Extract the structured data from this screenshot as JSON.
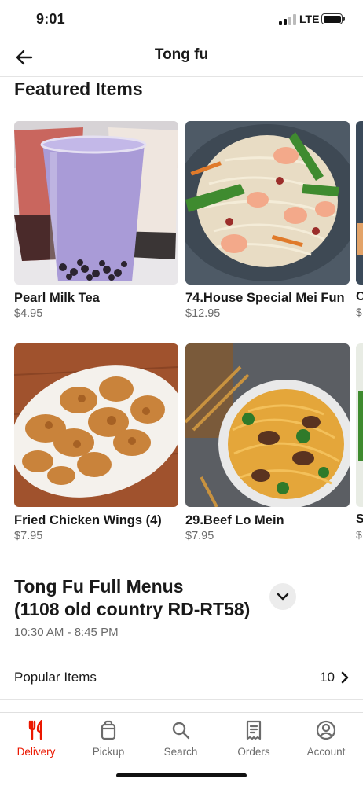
{
  "status_bar": {
    "time": "9:01",
    "network": "LTE"
  },
  "header": {
    "title": "Tong fu",
    "back_icon": "back-arrow-icon"
  },
  "featured": {
    "title": "Featured Items",
    "items": [
      {
        "name": "Pearl Milk Tea",
        "price": "$4.95"
      },
      {
        "name": "74.House Special Mei Fun",
        "price": "$12.95"
      },
      {
        "name": "Fried Chicken Wings (4)",
        "price": "$7.95"
      },
      {
        "name": "29.Beef  Lo Mein",
        "price": "$7.95"
      }
    ],
    "peek": {
      "top_name": "C",
      "top_price": "$",
      "bottom_name": "S",
      "bottom_price": "$"
    }
  },
  "menu": {
    "title_line1": "Tong Fu Full Menus",
    "title_line2": "(1108 old country RD-RT58)",
    "hours": "10:30 AM - 8:45 PM",
    "expand_icon": "chevron-down-icon"
  },
  "popular": {
    "label": "Popular Items",
    "count": "10"
  },
  "tabs": [
    {
      "label": "Delivery",
      "icon": "fork-knife-icon",
      "active": true
    },
    {
      "label": "Pickup",
      "icon": "bag-icon",
      "active": false
    },
    {
      "label": "Search",
      "icon": "search-icon",
      "active": false
    },
    {
      "label": "Orders",
      "icon": "receipt-icon",
      "active": false
    },
    {
      "label": "Account",
      "icon": "account-icon",
      "active": false
    }
  ],
  "colors": {
    "accent": "#eb1700",
    "muted_text": "#6b6b6b",
    "divider": "#e4e4e4"
  }
}
